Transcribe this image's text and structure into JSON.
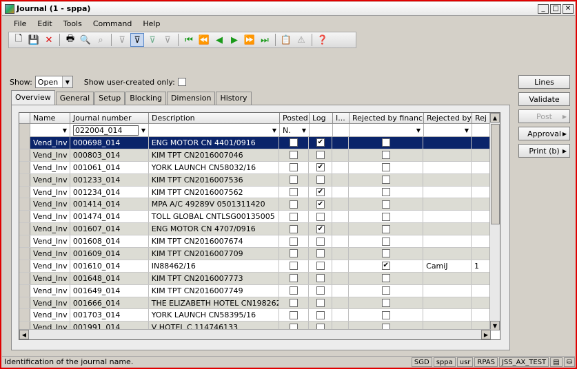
{
  "window": {
    "title": "Journal (1 - sppa)"
  },
  "menu": [
    "File",
    "Edit",
    "Tools",
    "Command",
    "Help"
  ],
  "toolbar": {
    "icons": [
      "new-icon",
      "save-icon",
      "delete-icon",
      "print-icon",
      "print-preview-icon",
      "find-icon",
      "filter-icon",
      "filter-by-selection-icon",
      "advanced-filter-icon",
      "remove-filter-icon",
      "first-record-icon",
      "previous-page-icon",
      "previous-record-icon",
      "next-record-icon",
      "next-page-icon",
      "last-record-icon",
      "attachments-icon",
      "alert-icon",
      "help-icon"
    ]
  },
  "show": {
    "label": "Show:",
    "value": "Open",
    "user_created_label": "Show user-created only:"
  },
  "tabs": [
    "Overview",
    "General",
    "Setup",
    "Blocking",
    "Dimension",
    "History"
  ],
  "grid": {
    "columns": [
      "Name",
      "Journal number",
      "Description",
      "Posted",
      "Log",
      "I...",
      "Rejected by finance",
      "Rejected by",
      "Rej"
    ],
    "filter": {
      "journal_number": "022004_014",
      "posted": "N."
    },
    "rows": [
      {
        "name": "Vend_Inv",
        "num": "000698_014",
        "desc": "ENG MOTOR CN 4401/0916",
        "posted": false,
        "log": true,
        "rej": false,
        "by": "",
        "r": "",
        "selected": true
      },
      {
        "name": "Vend_Inv",
        "num": "000803_014",
        "desc": "KIM TPT CN2016007046",
        "posted": false,
        "log": false,
        "rej": false,
        "by": "",
        "r": ""
      },
      {
        "name": "Vend_Inv",
        "num": "001061_014",
        "desc": "YORK LAUNCH CN58032/16",
        "posted": false,
        "log": true,
        "rej": false,
        "by": "",
        "r": ""
      },
      {
        "name": "Vend_Inv",
        "num": "001233_014",
        "desc": "KIM TPT CN2016007536",
        "posted": false,
        "log": false,
        "rej": false,
        "by": "",
        "r": ""
      },
      {
        "name": "Vend_Inv",
        "num": "001234_014",
        "desc": "KIM TPT CN2016007562",
        "posted": false,
        "log": true,
        "rej": false,
        "by": "",
        "r": ""
      },
      {
        "name": "Vend_Inv",
        "num": "001414_014",
        "desc": "MPA A/C 49289V 0501311420",
        "posted": false,
        "log": true,
        "rej": false,
        "by": "",
        "r": ""
      },
      {
        "name": "Vend_Inv",
        "num": "001474_014",
        "desc": "TOLL GLOBAL CNTLSG00135005",
        "posted": false,
        "log": false,
        "rej": false,
        "by": "",
        "r": ""
      },
      {
        "name": "Vend_Inv",
        "num": "001607_014",
        "desc": "ENG MOTOR CN 4707/0916",
        "posted": false,
        "log": true,
        "rej": false,
        "by": "",
        "r": ""
      },
      {
        "name": "Vend_Inv",
        "num": "001608_014",
        "desc": "KIM TPT CN2016007674",
        "posted": false,
        "log": false,
        "rej": false,
        "by": "",
        "r": ""
      },
      {
        "name": "Vend_Inv",
        "num": "001609_014",
        "desc": "KIM TPT CN2016007709",
        "posted": false,
        "log": false,
        "rej": false,
        "by": "",
        "r": ""
      },
      {
        "name": "Vend_Inv",
        "num": "001610_014",
        "desc": "IN88462/16",
        "posted": false,
        "log": false,
        "rej": true,
        "by": "CamiJ",
        "r": "1"
      },
      {
        "name": "Vend_Inv",
        "num": "001648_014",
        "desc": "KIM TPT CN2016007773",
        "posted": false,
        "log": false,
        "rej": false,
        "by": "",
        "r": ""
      },
      {
        "name": "Vend_Inv",
        "num": "001649_014",
        "desc": "KIM TPT CN2016007749",
        "posted": false,
        "log": false,
        "rej": false,
        "by": "",
        "r": ""
      },
      {
        "name": "Vend_Inv",
        "num": "001666_014",
        "desc": "THE ELIZABETH HOTEL CN198262",
        "posted": false,
        "log": false,
        "rej": false,
        "by": "",
        "r": ""
      },
      {
        "name": "Vend_Inv",
        "num": "001703_014",
        "desc": "YORK LAUNCH CN58395/16",
        "posted": false,
        "log": false,
        "rej": false,
        "by": "",
        "r": ""
      },
      {
        "name": "Vend_Inv",
        "num": "001991_014",
        "desc": "V HOTEL C  114746133",
        "posted": false,
        "log": false,
        "rej": false,
        "by": "",
        "r": ""
      }
    ]
  },
  "side_buttons": {
    "lines": "Lines",
    "validate": "Validate",
    "post": "Post",
    "approval": "Approval",
    "print": "Print (b)"
  },
  "status": {
    "message": "Identification of the journal name.",
    "currency": "SGD",
    "company": "sppa",
    "layer": "usr",
    "domain": "RPAS",
    "server": "JSS_AX_TEST"
  }
}
